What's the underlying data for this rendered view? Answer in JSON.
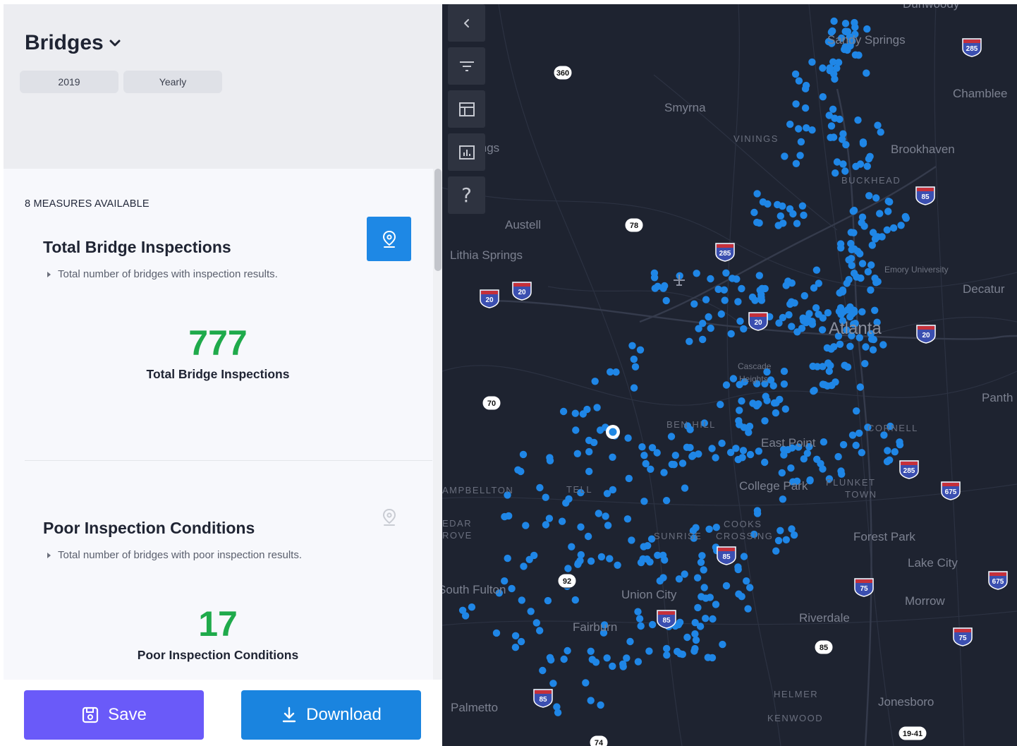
{
  "panel": {
    "title": "Bridges",
    "filters": [
      "2019",
      "Yearly"
    ],
    "measures_count_label": "8 MEASURES AVAILABLE"
  },
  "measures": [
    {
      "title": "Total Bridge Inspections",
      "description": "Total number of bridges with inspection results.",
      "value": "777",
      "value_label": "Total Bridge Inspections",
      "map_active": true
    },
    {
      "title": "Poor Inspection Conditions",
      "description": "Total number of bridges with poor inspection results.",
      "value": "17",
      "value_label": "Poor Inspection Conditions",
      "map_active": false
    }
  ],
  "actions": {
    "save_label": "Save",
    "download_label": "Download"
  },
  "map": {
    "toolbar_icons": [
      "chevron-left-icon",
      "filter-icon",
      "table-icon",
      "bar-chart-icon",
      "help-icon"
    ],
    "help_glyph": "?",
    "places": {
      "sandy_springs": "Sandy Springs",
      "dunwoody": "Dunwoody",
      "chamblee": "Chamblee",
      "smyrna": "Smyrna",
      "vinings": "VININGS",
      "brookhaven": "Brookhaven",
      "buckhead": "BUCKHEAD",
      "austell": "Austell",
      "lithia_springs": "Lithia Springs",
      "mableton_frag": "ings",
      "emory": "Emory University",
      "decatur": "Decatur",
      "atlanta": "Atlanta",
      "cascade": "Cascade",
      "heights": "Heights",
      "panth": "Panth",
      "ben_hill": "BEN HILL",
      "east_point": "East Point",
      "cornell": "CORNELL",
      "campbellton": "AMPBELLTON",
      "tell": "TELL",
      "college_park": "College Park",
      "plunket": "PLUNKET",
      "town": "TOWN",
      "cedar": "EDAR",
      "grove": "ROVE",
      "sunrise": "SUNRISE",
      "cooks": "COOKS",
      "crossing": "CROSSING",
      "forest_park": "Forest Park",
      "lake_city": "Lake City",
      "south_fulton": "South Fulton",
      "union_city": "Union City",
      "morrow": "Morrow",
      "riverdale": "Riverdale",
      "fairburn": "Fairburn",
      "helmer": "HELMER",
      "jonesboro": "Jonesboro",
      "palmetto": "Palmetto",
      "kenwood": "KENWOOD"
    },
    "shields": {
      "interstate": [
        "285",
        "85",
        "20",
        "20",
        "20",
        "285",
        "20",
        "285",
        "85",
        "675",
        "75",
        "675",
        "85",
        "75",
        "85"
      ],
      "us_state": [
        "360",
        "78",
        "70",
        "92",
        "85",
        "74",
        "19-41"
      ]
    }
  }
}
